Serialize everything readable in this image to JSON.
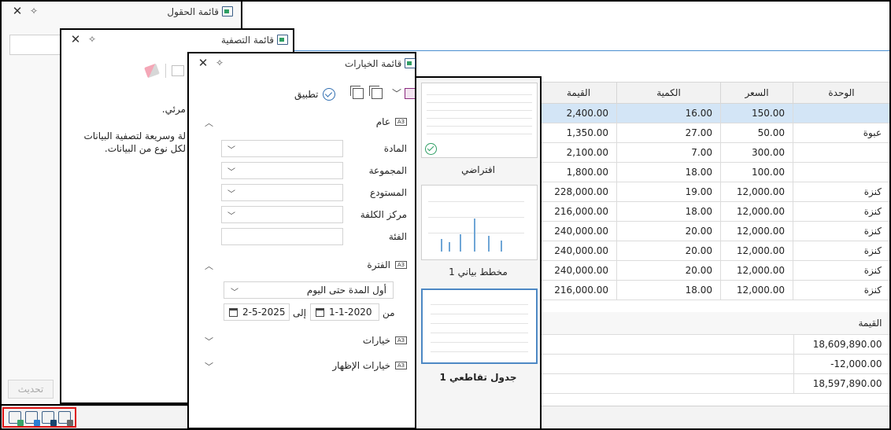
{
  "grid": {
    "headers": [
      "القيمة",
      "الكمية",
      "السعر",
      "الوحدة"
    ],
    "rows": [
      {
        "value": "2,400.00",
        "qty": "16.00",
        "price": "150.00",
        "unit": ""
      },
      {
        "value": "1,350.00",
        "qty": "27.00",
        "price": "50.00",
        "unit": "عبوة"
      },
      {
        "value": "2,100.00",
        "qty": "7.00",
        "price": "300.00",
        "unit": ""
      },
      {
        "value": "1,800.00",
        "qty": "18.00",
        "price": "100.00",
        "unit": ""
      },
      {
        "value": "228,000.00",
        "qty": "19.00",
        "price": "12,000.00",
        "unit": "كنزة"
      },
      {
        "value": "216,000.00",
        "qty": "18.00",
        "price": "12,000.00",
        "unit": "كنزة"
      },
      {
        "value": "240,000.00",
        "qty": "20.00",
        "price": "12,000.00",
        "unit": "كنزة"
      },
      {
        "value": "240,000.00",
        "qty": "20.00",
        "price": "12,000.00",
        "unit": "كنزة"
      },
      {
        "value": "240,000.00",
        "qty": "20.00",
        "price": "12,000.00",
        "unit": "كنزة"
      },
      {
        "value": "216,000.00",
        "qty": "18.00",
        "price": "12,000.00",
        "unit": "كنزة"
      }
    ]
  },
  "summary": {
    "header": "القيمة",
    "values": [
      "18,609,890.00",
      "-12,000.00",
      "18,597,890.00"
    ]
  },
  "fields_panel": {
    "title": "قائمة الحقول",
    "refresh_label": "تحديث"
  },
  "filter_panel": {
    "title": "قائمة التصفية",
    "text_1": "مرئي.",
    "text_2": "لة وسريعة لتصفية البيانات",
    "text_3": "لكل نوع من البيانات."
  },
  "options_panel": {
    "title": "قائمة الخيارات",
    "apply_label": "تطبيق",
    "sections": {
      "general": "عام",
      "period": "الفترة",
      "options": "خيارات",
      "display_options": "خيارات الإظهار"
    },
    "section_icon_text": "A3",
    "fields": {
      "material": "المادة",
      "group": "المجموعة",
      "warehouse": "المستودع",
      "cost_center": "مركز الكلفة",
      "category": "الفئة"
    },
    "period": {
      "selected": "أول المدة حتى اليوم",
      "from_label": "من",
      "from_date": "1-1-2020",
      "to_label": "إلى",
      "to_date": "2-5-2025"
    }
  },
  "templates": [
    {
      "label": "افتراضي",
      "selected": false
    },
    {
      "label": "مخطط بياني 1",
      "selected": false
    },
    {
      "label": "جدول تقاطعي 1",
      "selected": true
    }
  ],
  "colors": {
    "selected_row": "#d3e5f6",
    "accent_blue": "#4d88c4",
    "highlight_red": "#dd1111"
  }
}
